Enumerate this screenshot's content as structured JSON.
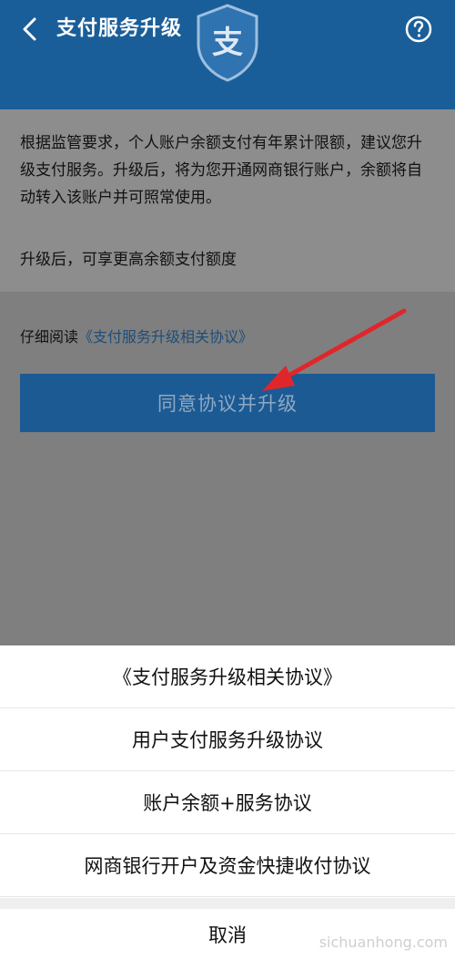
{
  "header": {
    "title": "支付服务升级",
    "logo_char": "支"
  },
  "content": {
    "description": "根据监管要求，个人账户余额支付有年累计限额，建议您升级支付服务。升级后，将为您开通网商银行账户，余额将自动转入该账户并可照常使用。",
    "benefit": "升级后，可享更高余额支付额度",
    "read_prefix": "仔细阅读",
    "read_link": "《支付服务升级相关协议》",
    "agree_button": "同意协议并升级"
  },
  "sheet": {
    "items": [
      "《支付服务升级相关协议》",
      "用户支付服务升级协议",
      "账户余额+服务协议",
      "网商银行开户及资金快捷收付协议"
    ],
    "cancel": "取消"
  },
  "watermark": "sichuanhong.com",
  "colors": {
    "header_bg": "#1a5e99",
    "overlay_bg": "#7f7f7f",
    "button_bg": "#1c5a93",
    "arrow": "#e0262b"
  },
  "icons": {
    "back": "back-chevron-icon",
    "help": "question-circle-icon",
    "logo": "shield-logo-icon"
  }
}
